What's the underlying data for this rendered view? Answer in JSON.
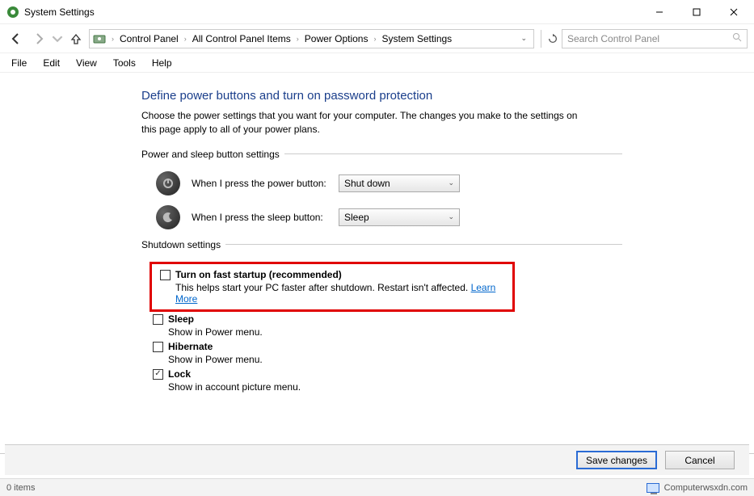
{
  "window": {
    "title": "System Settings"
  },
  "win_controls": {
    "min": "minimize",
    "max": "maximize",
    "close": "close"
  },
  "nav": {
    "breadcrumb": [
      "Control Panel",
      "All Control Panel Items",
      "Power Options",
      "System Settings"
    ]
  },
  "search": {
    "placeholder": "Search Control Panel"
  },
  "menu": [
    "File",
    "Edit",
    "View",
    "Tools",
    "Help"
  ],
  "page": {
    "title": "Define power buttons and turn on password protection",
    "description": "Choose the power settings that you want for your computer. The changes you make to the settings on this page apply to all of your power plans."
  },
  "power_sleep_section": "Power and sleep button settings",
  "power_button": {
    "label": "When I press the power button:",
    "value": "Shut down"
  },
  "sleep_button": {
    "label": "When I press the sleep button:",
    "value": "Sleep"
  },
  "shutdown_section": "Shutdown settings",
  "fast_startup": {
    "label": "Turn on fast startup (recommended)",
    "desc": "This helps start your PC faster after shutdown. Restart isn't affected. ",
    "link": "Learn More",
    "checked": false
  },
  "sleep_opt": {
    "label": "Sleep",
    "desc": "Show in Power menu.",
    "checked": false
  },
  "hibernate_opt": {
    "label": "Hibernate",
    "desc": "Show in Power menu.",
    "checked": false
  },
  "lock_opt": {
    "label": "Lock",
    "desc": "Show in account picture menu.",
    "checked": true
  },
  "buttons": {
    "save": "Save changes",
    "cancel": "Cancel"
  },
  "status": {
    "left": "0 items",
    "right": "Computerwsxdn.com"
  }
}
